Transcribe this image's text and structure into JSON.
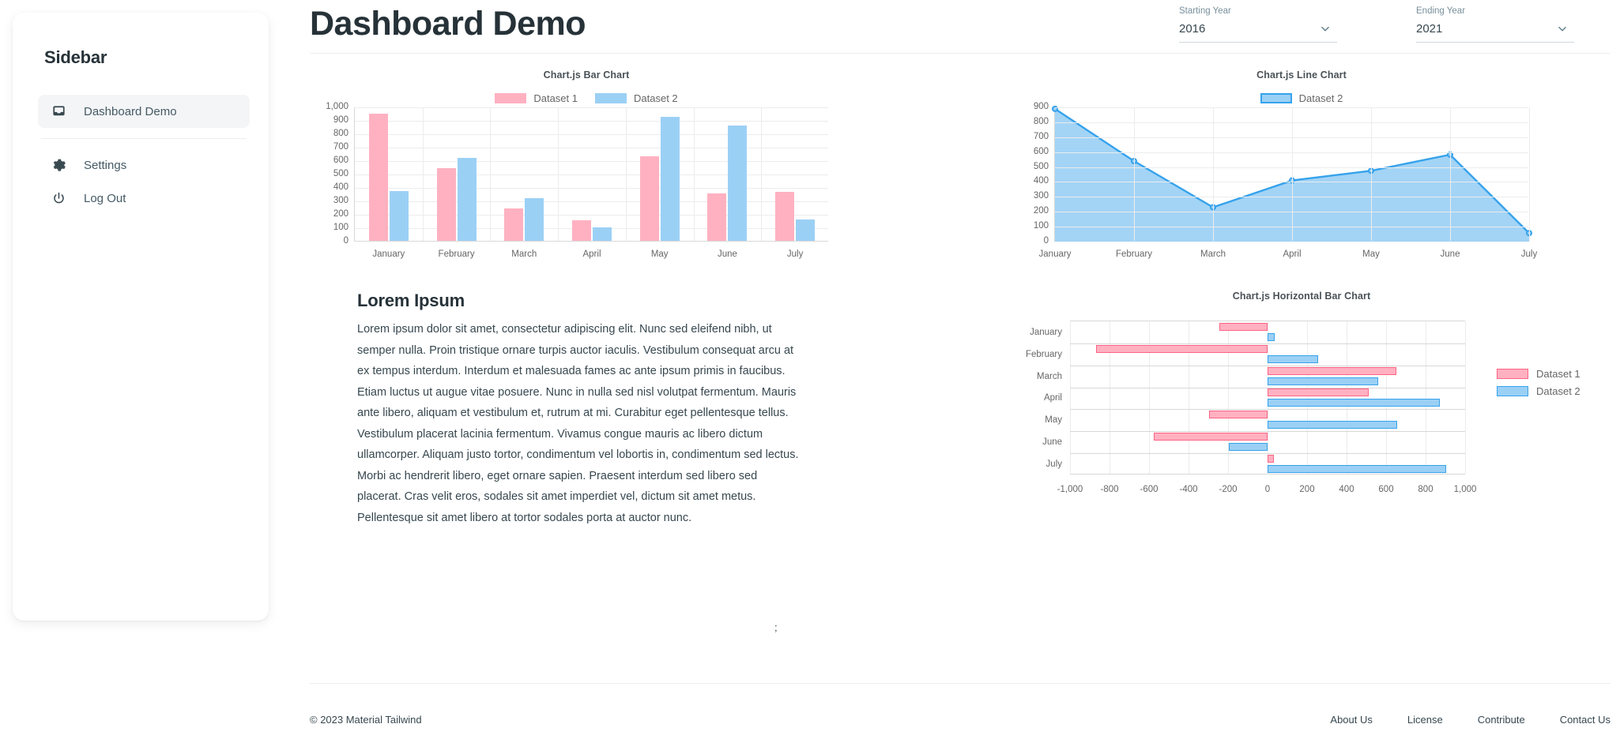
{
  "sidebar": {
    "title": "Sidebar",
    "items": [
      {
        "label": "Dashboard Demo",
        "icon": "inbox-icon",
        "active": true
      },
      {
        "label": "Settings",
        "icon": "gear-icon",
        "active": false
      },
      {
        "label": "Log Out",
        "icon": "power-icon",
        "active": false
      }
    ]
  },
  "header": {
    "title": "Dashboard Demo",
    "starting_year": {
      "label": "Starting Year",
      "value": "2016"
    },
    "ending_year": {
      "label": "Ending Year",
      "value": "2021"
    }
  },
  "colors": {
    "dataset1_fill": "#FFB1C1",
    "dataset1_border": "#FF6384",
    "dataset2_fill": "#9BD0F5",
    "dataset2_border": "#36A2EB",
    "text": "#37474F",
    "muted": "#666666",
    "grid": "#ECECEC"
  },
  "lorem": {
    "title": "Lorem Ipsum",
    "body": "Lorem ipsum dolor sit amet, consectetur adipiscing elit. Nunc sed eleifend nibh, ut semper nulla. Proin tristique ornare turpis auctor iaculis. Vestibulum consequat arcu at ex tempus interdum. Interdum et malesuada fames ac ante ipsum primis in faucibus. Etiam luctus ut augue vitae posuere. Nunc in nulla sed nisl volutpat fermentum. Mauris ante libero, aliquam et vestibulum et, rutrum at mi. Curabitur eget pellentesque tellus. Vestibulum placerat lacinia fermentum. Vivamus congue mauris ac libero dictum ullamcorper. Aliquam justo tortor, condimentum vel lobortis in, condimentum sed lectus. Morbi ac hendrerit libero, eget ornare sapien. Praesent interdum sed libero sed placerat. Cras velit eros, sodales sit amet imperdiet vel, dictum sit amet metus. Pellentesque sit amet libero at tortor sodales porta at auctor nunc."
  },
  "stray_char": ";",
  "footer": {
    "copyright": "© 2023 Material Tailwind",
    "links": [
      "About Us",
      "License",
      "Contribute",
      "Contact Us"
    ]
  },
  "chart_data": [
    {
      "id": "bar",
      "type": "bar",
      "title": "Chart.js Bar Chart",
      "categories": [
        "January",
        "February",
        "March",
        "April",
        "May",
        "June",
        "July"
      ],
      "series": [
        {
          "name": "Dataset 1",
          "color": "#FFB1C1",
          "values": [
            945,
            543,
            243,
            153,
            630,
            352,
            367
          ]
        },
        {
          "name": "Dataset 2",
          "color": "#9BD0F5",
          "values": [
            371,
            616,
            318,
            100,
            924,
            861,
            158
          ]
        }
      ],
      "xlabel": "",
      "ylabel": "",
      "ylim": [
        0,
        1000
      ],
      "yticks": [
        "0",
        "100",
        "200",
        "300",
        "400",
        "500",
        "600",
        "700",
        "800",
        "900",
        "1,000"
      ],
      "grid": true,
      "legend": "top"
    },
    {
      "id": "line",
      "type": "area",
      "title": "Chart.js Line Chart",
      "categories": [
        "January",
        "February",
        "March",
        "April",
        "May",
        "June",
        "July"
      ],
      "series": [
        {
          "name": "Dataset 2",
          "color": "#36A2EB",
          "fill": "#9BD0F5",
          "values": [
            890,
            540,
            230,
            410,
            475,
            583,
            57
          ]
        }
      ],
      "xlabel": "",
      "ylabel": "",
      "ylim": [
        0,
        900
      ],
      "yticks": [
        "0",
        "100",
        "200",
        "300",
        "400",
        "500",
        "600",
        "700",
        "800",
        "900"
      ],
      "grid": true,
      "legend": "top"
    },
    {
      "id": "hbar",
      "type": "bar",
      "orientation": "horizontal",
      "title": "Chart.js Horizontal Bar Chart",
      "categories": [
        "January",
        "February",
        "March",
        "April",
        "May",
        "June",
        "July"
      ],
      "series": [
        {
          "name": "Dataset 1",
          "color": "#FFB1C1",
          "values": [
            -245,
            -870,
            650,
            510,
            -295,
            -575,
            30
          ]
        },
        {
          "name": "Dataset 2",
          "color": "#9BD0F5",
          "values": [
            35,
            255,
            560,
            870,
            655,
            -195,
            905
          ]
        }
      ],
      "xlabel": "",
      "ylabel": "",
      "xlim": [
        -1000,
        1000
      ],
      "xticks": [
        "-1,000",
        "-800",
        "-600",
        "-400",
        "-200",
        "0",
        "200",
        "400",
        "600",
        "800",
        "1,000"
      ],
      "grid": true,
      "legend": "right"
    }
  ]
}
